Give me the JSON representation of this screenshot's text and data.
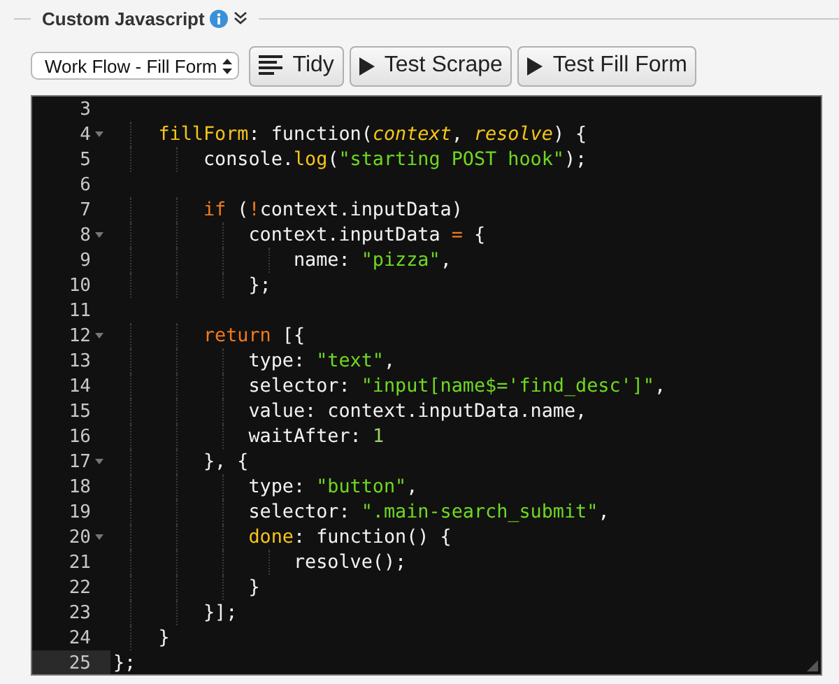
{
  "section": {
    "title": "Custom Javascript",
    "expanded": true
  },
  "toolbar": {
    "select": {
      "value": "Work Flow - Fill Form"
    },
    "buttons": [
      {
        "kind": "tidy",
        "label": "Tidy"
      },
      {
        "kind": "play",
        "label": "Test Scrape"
      },
      {
        "kind": "play",
        "label": "Test Fill Form"
      }
    ]
  },
  "editor": {
    "lines": [
      {
        "number": "3",
        "foldable": false,
        "active": false
      },
      {
        "number": "4",
        "foldable": true,
        "active": false,
        "tokens": [
          {
            "kind": "name",
            "text": "    fillForm"
          },
          {
            "kind": "plain",
            "text": ": function("
          },
          {
            "kind": "param",
            "text": "context"
          },
          {
            "kind": "plain",
            "text": ", "
          },
          {
            "kind": "param",
            "text": "resolve"
          },
          {
            "kind": "plain",
            "text": ") {"
          }
        ]
      },
      {
        "number": "5",
        "foldable": false,
        "active": false,
        "tokens": [
          {
            "kind": "plain",
            "text": "        console."
          },
          {
            "kind": "name",
            "text": "log"
          },
          {
            "kind": "plain",
            "text": "("
          },
          {
            "kind": "string",
            "text": "\"starting POST hook\""
          },
          {
            "kind": "plain",
            "text": ");"
          }
        ]
      },
      {
        "number": "6",
        "foldable": false,
        "active": false
      },
      {
        "number": "7",
        "foldable": false,
        "active": false,
        "tokens": [
          {
            "kind": "keyword",
            "text": "        if"
          },
          {
            "kind": "plain",
            "text": " ("
          },
          {
            "kind": "keyword",
            "text": "!"
          },
          {
            "kind": "plain",
            "text": "context.inputData)"
          }
        ]
      },
      {
        "number": "8",
        "foldable": true,
        "active": false,
        "tokens": [
          {
            "kind": "plain",
            "text": "            context.inputData "
          },
          {
            "kind": "keyword",
            "text": "="
          },
          {
            "kind": "plain",
            "text": " {"
          }
        ]
      },
      {
        "number": "9",
        "foldable": false,
        "active": false,
        "tokens": [
          {
            "kind": "plain",
            "text": "                name: "
          },
          {
            "kind": "string",
            "text": "\"pizza\""
          },
          {
            "kind": "plain",
            "text": ","
          }
        ]
      },
      {
        "number": "10",
        "foldable": false,
        "active": false,
        "tokens": [
          {
            "kind": "plain",
            "text": "            };"
          }
        ]
      },
      {
        "number": "11",
        "foldable": false,
        "active": false
      },
      {
        "number": "12",
        "foldable": true,
        "active": false,
        "tokens": [
          {
            "kind": "keyword",
            "text": "        return"
          },
          {
            "kind": "plain",
            "text": " [{"
          }
        ]
      },
      {
        "number": "13",
        "foldable": false,
        "active": false,
        "tokens": [
          {
            "kind": "plain",
            "text": "            type: "
          },
          {
            "kind": "string",
            "text": "\"text\""
          },
          {
            "kind": "plain",
            "text": ","
          }
        ]
      },
      {
        "number": "14",
        "foldable": false,
        "active": false,
        "tokens": [
          {
            "kind": "plain",
            "text": "            selector: "
          },
          {
            "kind": "string",
            "text": "\"input[name$='find_desc']\""
          },
          {
            "kind": "plain",
            "text": ","
          }
        ]
      },
      {
        "number": "15",
        "foldable": false,
        "active": false,
        "tokens": [
          {
            "kind": "plain",
            "text": "            value: context.inputData.name,"
          }
        ]
      },
      {
        "number": "16",
        "foldable": false,
        "active": false,
        "tokens": [
          {
            "kind": "plain",
            "text": "            waitAfter: "
          },
          {
            "kind": "number",
            "text": "1"
          }
        ]
      },
      {
        "number": "17",
        "foldable": true,
        "active": false,
        "tokens": [
          {
            "kind": "plain",
            "text": "        }, {"
          }
        ]
      },
      {
        "number": "18",
        "foldable": false,
        "active": false,
        "tokens": [
          {
            "kind": "plain",
            "text": "            type: "
          },
          {
            "kind": "string",
            "text": "\"button\""
          },
          {
            "kind": "plain",
            "text": ","
          }
        ]
      },
      {
        "number": "19",
        "foldable": false,
        "active": false,
        "tokens": [
          {
            "kind": "plain",
            "text": "            selector: "
          },
          {
            "kind": "string",
            "text": "\".main-search_submit\""
          },
          {
            "kind": "plain",
            "text": ","
          }
        ]
      },
      {
        "number": "20",
        "foldable": true,
        "active": false,
        "tokens": [
          {
            "kind": "name",
            "text": "            done"
          },
          {
            "kind": "plain",
            "text": ": function() {"
          }
        ]
      },
      {
        "number": "21",
        "foldable": false,
        "active": false,
        "tokens": [
          {
            "kind": "plain",
            "text": "                resolve();"
          }
        ]
      },
      {
        "number": "22",
        "foldable": false,
        "active": false,
        "tokens": [
          {
            "kind": "plain",
            "text": "            }"
          }
        ]
      },
      {
        "number": "23",
        "foldable": false,
        "active": false,
        "tokens": [
          {
            "kind": "plain",
            "text": "        }];"
          }
        ]
      },
      {
        "number": "24",
        "foldable": false,
        "active": false,
        "tokens": [
          {
            "kind": "plain",
            "text": "    }"
          }
        ]
      },
      {
        "number": "25",
        "foldable": false,
        "active": true,
        "tokens": [
          {
            "kind": "plain",
            "text": "};"
          }
        ]
      }
    ]
  }
}
